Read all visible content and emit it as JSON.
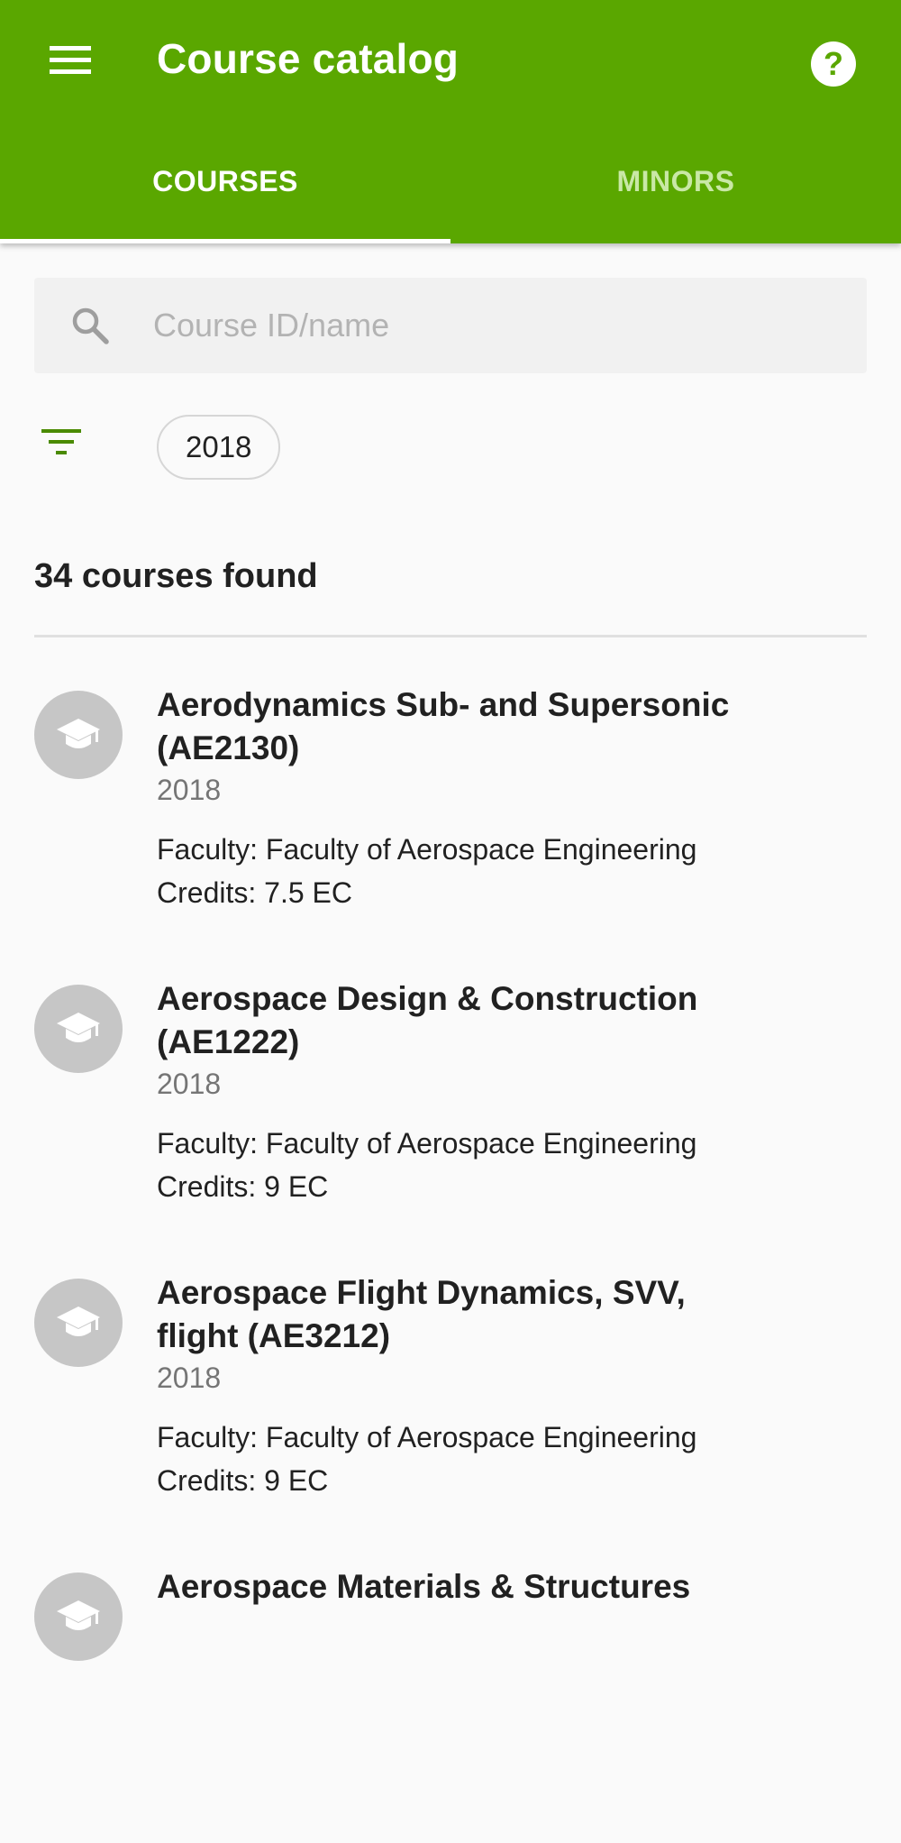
{
  "app": {
    "title": "Course catalog",
    "theme_color": "#5aa700",
    "menu_icon": "menu-icon",
    "help_icon": "help-circle-icon"
  },
  "tabs": [
    {
      "label": "COURSES",
      "active": true
    },
    {
      "label": "MINORS",
      "active": false
    }
  ],
  "search": {
    "placeholder": "Course ID/name",
    "value": "",
    "icon": "search-icon"
  },
  "filters": {
    "icon": "filter-icon",
    "chips": [
      "2018"
    ]
  },
  "results": {
    "count_text": "34 courses found"
  },
  "courses": [
    {
      "title": "Aerodynamics Sub- and Supersonic (AE2130)",
      "year": "2018",
      "faculty": "Faculty: Faculty of Aerospace Engineering",
      "credits": "Credits: 7.5 EC"
    },
    {
      "title": "Aerospace Design & Construction (AE1222)",
      "year": "2018",
      "faculty": "Faculty: Faculty of Aerospace Engineering",
      "credits": "Credits: 9 EC"
    },
    {
      "title": "Aerospace Flight Dynamics, SVV, flight (AE3212)",
      "year": "2018",
      "faculty": "Faculty: Faculty of Aerospace Engineering",
      "credits": "Credits: 9 EC"
    },
    {
      "title": "Aerospace Materials & Structures",
      "year": "",
      "faculty": "",
      "credits": ""
    }
  ]
}
